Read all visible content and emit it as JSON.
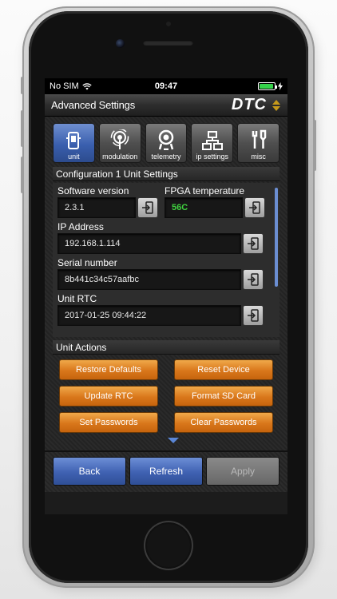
{
  "status": {
    "carrier": "No SIM",
    "time": "09:47",
    "battery_level": 0.95
  },
  "header": {
    "title": "Advanced Settings",
    "logo": "DTC"
  },
  "tabs": [
    {
      "label": "unit",
      "icon": "unit-icon",
      "active": true
    },
    {
      "label": "modulation",
      "icon": "antenna-icon",
      "active": false
    },
    {
      "label": "telemetry",
      "icon": "telemetry-icon",
      "active": false
    },
    {
      "label": "ip settings",
      "icon": "network-icon",
      "active": false
    },
    {
      "label": "misc",
      "icon": "tools-icon",
      "active": false
    }
  ],
  "config": {
    "heading": "Configuration 1 Unit Settings",
    "software_label": "Software version",
    "software_value": "2.3.1",
    "fpga_label": "FPGA temperature",
    "fpga_value": "56C",
    "ip_label": "IP Address",
    "ip_value": "192.168.1.114",
    "serial_label": "Serial number",
    "serial_value": "8b441c34c57aafbc",
    "rtc_label": "Unit RTC",
    "rtc_value": "2017-01-25 09:44:22"
  },
  "actions": {
    "heading": "Unit Actions",
    "restore_defaults": "Restore Defaults",
    "reset_device": "Reset Device",
    "update_rtc": "Update RTC",
    "format_sd": "Format SD Card",
    "set_passwords": "Set Passwords",
    "clear_passwords": "Clear Passwords"
  },
  "footer": {
    "back": "Back",
    "refresh": "Refresh",
    "apply": "Apply"
  },
  "colors": {
    "accent_blue": "#3f61b2",
    "action_orange": "#d9771b",
    "temp_green": "#3fd13f"
  }
}
